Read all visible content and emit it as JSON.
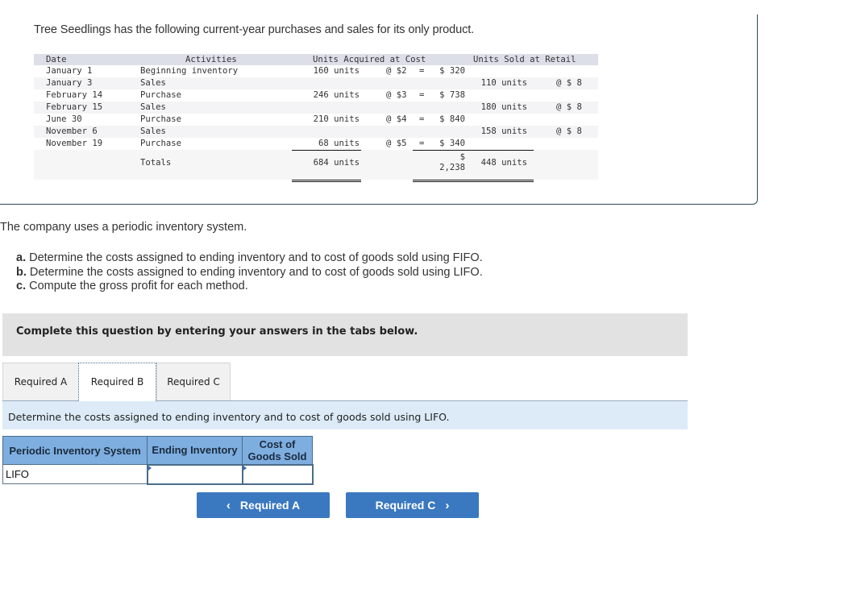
{
  "intro": "Tree Seedlings has the following current-year purchases and sales for its only product.",
  "inventory_table": {
    "headers": {
      "date": "Date",
      "activities": "Activities",
      "units_acquired": "Units Acquired at Cost",
      "units_sold": "Units Sold at Retail"
    },
    "rows": [
      {
        "date": "January 1",
        "activity": "Beginning inventory",
        "units": "160 units",
        "at": "@ $2",
        "eq": "=",
        "amount": "$ 320",
        "sold": "",
        "sold_at": ""
      },
      {
        "date": "January 3",
        "activity": "Sales",
        "units": "",
        "at": "",
        "eq": "",
        "amount": "",
        "sold": "110 units",
        "sold_at": "@ $ 8"
      },
      {
        "date": "February 14",
        "activity": "Purchase",
        "units": "246 units",
        "at": "@ $3",
        "eq": "=",
        "amount": "$ 738",
        "sold": "",
        "sold_at": ""
      },
      {
        "date": "February 15",
        "activity": "Sales",
        "units": "",
        "at": "",
        "eq": "",
        "amount": "",
        "sold": "180 units",
        "sold_at": "@ $ 8"
      },
      {
        "date": "June 30",
        "activity": "Purchase",
        "units": "210 units",
        "at": "@ $4",
        "eq": "=",
        "amount": "$ 840",
        "sold": "",
        "sold_at": ""
      },
      {
        "date": "November 6",
        "activity": "Sales",
        "units": "",
        "at": "",
        "eq": "",
        "amount": "",
        "sold": "158 units",
        "sold_at": "@ $ 8"
      },
      {
        "date": "November 19",
        "activity": "Purchase",
        "units": "68 units",
        "at": "@ $5",
        "eq": "=",
        "amount": "$ 340",
        "sold": "",
        "sold_at": ""
      }
    ],
    "totals": {
      "label": "Totals",
      "units": "684 units",
      "amount_symbol": "$",
      "amount": "2,238",
      "sold": "448 units"
    }
  },
  "periodic_text": "The company uses a periodic inventory system.",
  "requirements": [
    {
      "letter": "a.",
      "text": " Determine the costs assigned to ending inventory and to cost of goods sold using FIFO."
    },
    {
      "letter": "b.",
      "text": " Determine the costs assigned to ending inventory and to cost of goods sold using LIFO."
    },
    {
      "letter": "c.",
      "text": " Compute the gross profit for each method."
    }
  ],
  "instruction": "Complete this question by entering your answers in the tabs below.",
  "tabs": [
    {
      "label": "Required A",
      "active": false
    },
    {
      "label": "Required B",
      "active": true
    },
    {
      "label": "Required C",
      "active": false
    }
  ],
  "task_text": "Determine the costs assigned to ending inventory and to cost of goods sold using LIFO.",
  "answer_table": {
    "headers": [
      "Periodic Inventory System",
      "Ending Inventory",
      "Cost of Goods Sold"
    ],
    "rows": [
      {
        "label": "LIFO",
        "ending_inventory": "",
        "cogs": ""
      }
    ]
  },
  "nav": {
    "prev_label": "Required A",
    "next_label": "Required C",
    "prev_icon": "chevron-left-icon",
    "next_icon": "chevron-right-icon"
  },
  "colors": {
    "button_blue": "#3a78c0",
    "table_header_blue": "#7eaee0",
    "task_bar": "#dcebf7"
  }
}
